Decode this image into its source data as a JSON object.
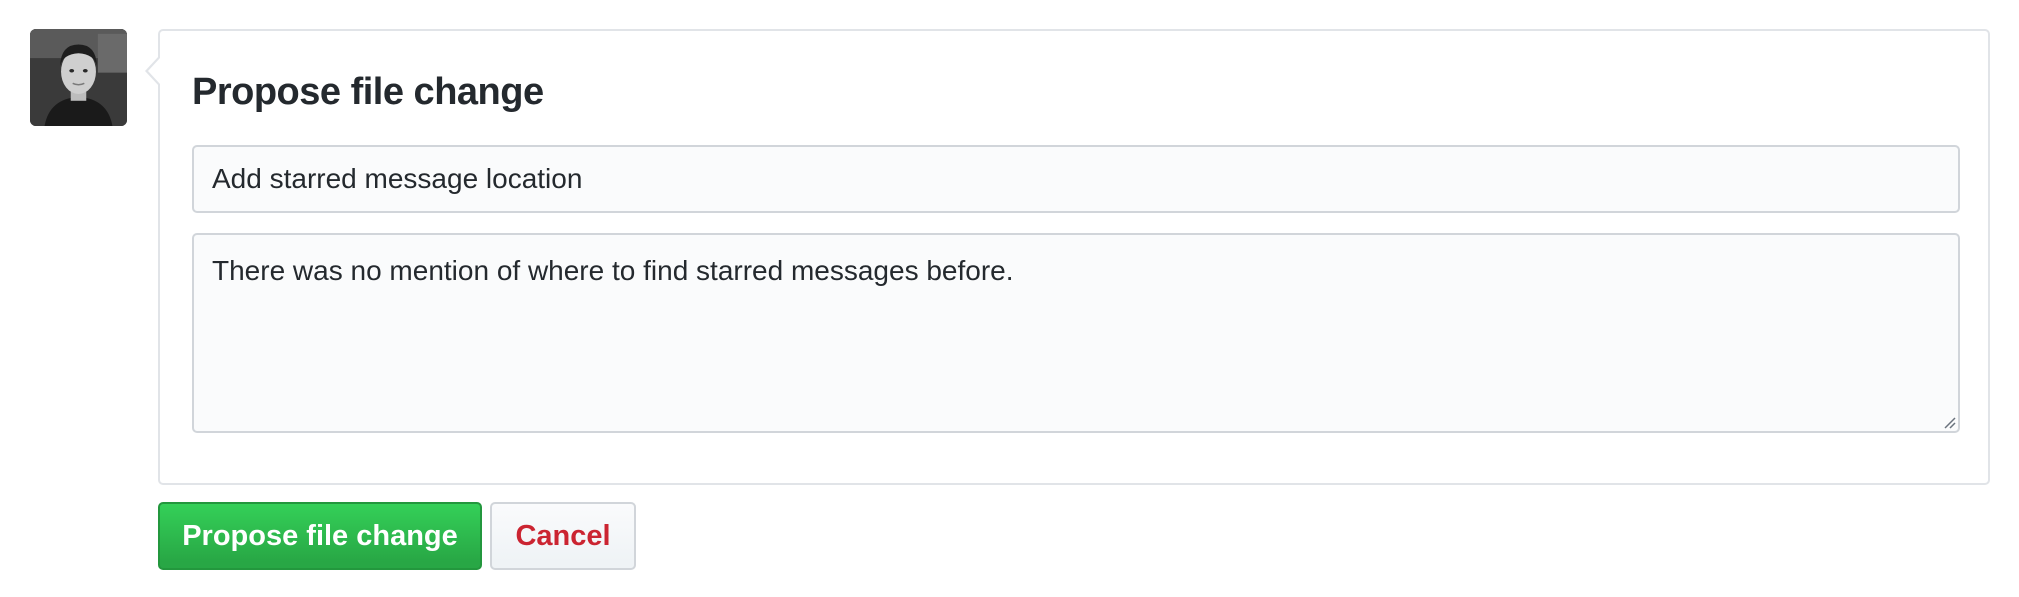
{
  "avatar": {
    "icon": "user-avatar"
  },
  "form": {
    "title": "Propose file change",
    "summary_value": "Add starred message location",
    "description_value": "There was no mention of where to find starred messages before."
  },
  "actions": {
    "submit_label": "Propose file change",
    "cancel_label": "Cancel"
  },
  "colors": {
    "primary": "#28a745",
    "danger": "#cb2431",
    "border": "#e1e4e8"
  }
}
